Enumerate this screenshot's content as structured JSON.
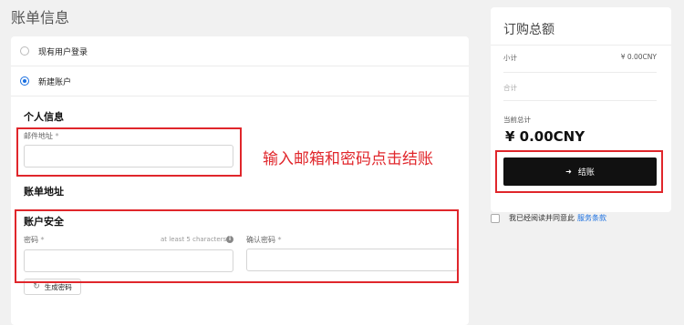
{
  "page": {
    "title": "账单信息"
  },
  "account_options": [
    {
      "label": "现有用户登录",
      "selected": false
    },
    {
      "label": "新建账户",
      "selected": true
    }
  ],
  "personal": {
    "heading": "个人信息",
    "email_label": "邮件地址",
    "email_value": ""
  },
  "billing_address": {
    "heading": "账单地址"
  },
  "security": {
    "heading": "账户安全",
    "password_label": "密码",
    "password_hint": "at least 5 characters",
    "password_value": "",
    "confirm_label": "确认密码",
    "confirm_value": "",
    "generate_button": "生成密码",
    "required_mark": "*"
  },
  "annotation": {
    "text": "输入邮箱和密码点击结账",
    "color": "#e0262b"
  },
  "order": {
    "title": "订购总额",
    "subtotal_label": "小计",
    "subtotal_value": "¥ 0.00CNY",
    "total_row_label": "合计",
    "current_total_label": "当前总计",
    "current_total_value": "¥ 0.00CNY",
    "checkout_button": "结账"
  },
  "terms": {
    "checked": false,
    "text": "我已经阅读并同意此",
    "link": "服务条款"
  },
  "colors": {
    "accent": "#1a6fe0",
    "button_bg": "#111111",
    "page_bg": "#f1f1f1"
  }
}
